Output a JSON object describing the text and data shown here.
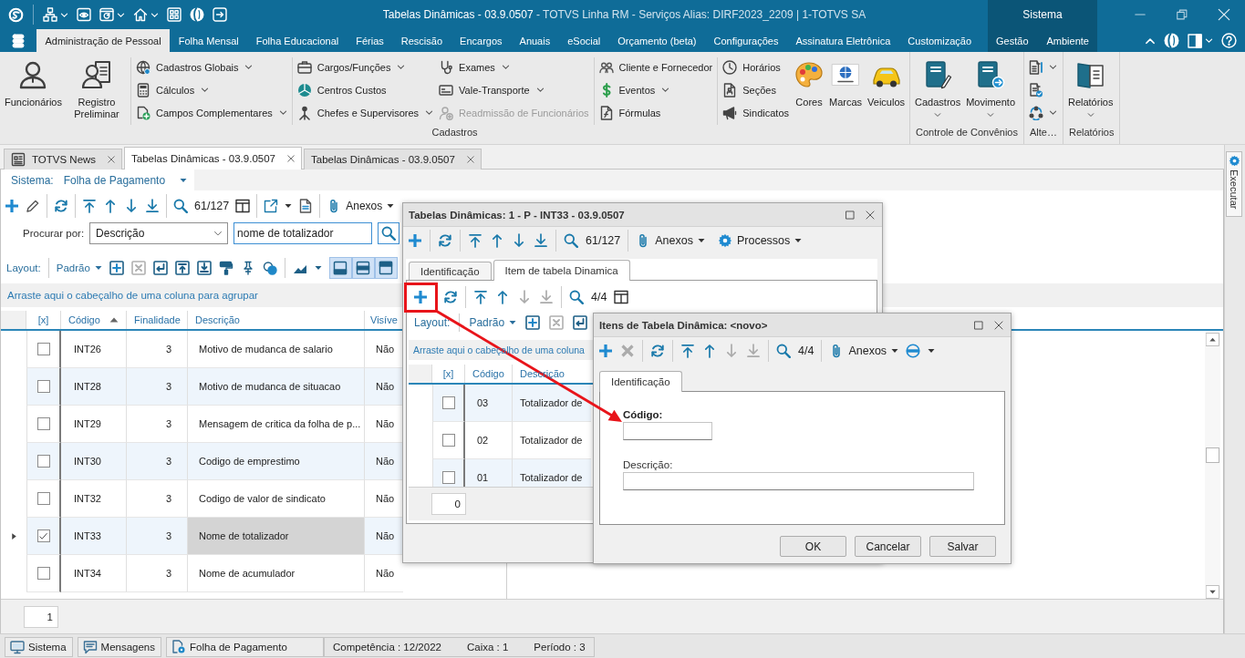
{
  "title_bar": {
    "title": "Tabelas Dinâmicas - 03.9.0507",
    "subtitle": "- TOTVS Linha RM - Serviços Alias: DIRF2023_2209 | 1-TOTVS SA",
    "context_label": "Sistema"
  },
  "ribbon": {
    "tabs": [
      {
        "label": "Administração de Pessoal",
        "selected": true
      },
      {
        "label": "Folha Mensal",
        "selected": false
      },
      {
        "label": "Folha Educacional",
        "selected": false
      },
      {
        "label": "Férias",
        "selected": false
      },
      {
        "label": "Rescisão",
        "selected": false
      },
      {
        "label": "Encargos",
        "selected": false
      },
      {
        "label": "Anuais",
        "selected": false
      },
      {
        "label": "eSocial",
        "selected": false
      },
      {
        "label": "Orçamento (beta)",
        "selected": false
      },
      {
        "label": "Configurações",
        "selected": false
      },
      {
        "label": "Assinatura Eletrônica",
        "selected": false
      },
      {
        "label": "Customização",
        "selected": false
      }
    ],
    "context_tabs": [
      {
        "label": "Gestão",
        "selected": false
      },
      {
        "label": "Ambiente",
        "selected": false
      }
    ],
    "groups": [
      {
        "label": "Cadastros",
        "clusters": [
          [
            {
              "kind": "large",
              "label": "Funcionários",
              "dropdown": false
            },
            {
              "kind": "large",
              "label": "Registro Preliminar",
              "dropdown": false
            }
          ],
          [
            {
              "kind": "stack",
              "items": [
                {
                  "label": "Cadastros Globais",
                  "dropdown": true,
                  "disabled": false
                },
                {
                  "label": "Cálculos",
                  "dropdown": true,
                  "disabled": false
                },
                {
                  "label": "Campos Complementares",
                  "dropdown": true,
                  "disabled": false
                }
              ]
            }
          ],
          [
            {
              "kind": "stack",
              "items": [
                {
                  "label": "Cargos/Funções",
                  "dropdown": true,
                  "disabled": false
                },
                {
                  "label": "Centros Custos",
                  "dropdown": false,
                  "disabled": false
                },
                {
                  "label": "Chefes e Supervisores",
                  "dropdown": true,
                  "disabled": false
                }
              ]
            },
            {
              "kind": "stack",
              "items": [
                {
                  "label": "Exames",
                  "dropdown": true,
                  "disabled": false
                },
                {
                  "label": "Vale-Transporte",
                  "dropdown": true,
                  "disabled": false
                },
                {
                  "label": "Readmissão de Funcionários",
                  "dropdown": false,
                  "disabled": true
                }
              ]
            }
          ],
          [
            {
              "kind": "stack",
              "items": [
                {
                  "label": "Cliente e Fornecedor",
                  "dropdown": false,
                  "disabled": false
                },
                {
                  "label": "Eventos",
                  "dropdown": true,
                  "disabled": false
                },
                {
                  "label": "Fórmulas",
                  "dropdown": false,
                  "disabled": false
                }
              ]
            }
          ],
          [
            {
              "kind": "stack",
              "items": [
                {
                  "label": "Horários",
                  "dropdown": false,
                  "disabled": false
                },
                {
                  "label": "Seções",
                  "dropdown": false,
                  "disabled": false
                },
                {
                  "label": "Sindicatos",
                  "dropdown": false,
                  "disabled": false
                }
              ]
            },
            {
              "kind": "large",
              "label": "Cores",
              "dropdown": false
            },
            {
              "kind": "large",
              "label": "Marcas",
              "dropdown": false
            },
            {
              "kind": "large",
              "label": "Veiculos",
              "dropdown": false
            }
          ]
        ]
      },
      {
        "label": "Controle de Convênios",
        "clusters": [
          [
            {
              "kind": "large",
              "label": "Cadastros",
              "dropdown": true
            },
            {
              "kind": "large",
              "label": "Movimento",
              "dropdown": true
            }
          ]
        ]
      },
      {
        "label": "Alte…",
        "clusters": [
          [
            {
              "kind": "icons",
              "items": [
                {
                  "dropdown": true
                },
                {
                  "dropdown": false
                },
                {
                  "dropdown": true
                }
              ]
            }
          ]
        ]
      },
      {
        "label": "Relatórios",
        "clusters": [
          [
            {
              "kind": "large",
              "label": "Relatórios",
              "dropdown": true
            }
          ]
        ]
      }
    ]
  },
  "document_tabs": [
    {
      "label": "TOTVS News",
      "selected": false
    },
    {
      "label": "Tabelas Dinâmicas - 03.9.0507",
      "selected": true
    },
    {
      "label": "Tabelas Dinâmicas - 03.9.0507",
      "selected": false
    }
  ],
  "side_panel": {
    "label": "Executar"
  },
  "main_view": {
    "system_selector": {
      "label": "Sistema:",
      "value": "Folha de Pagamento"
    },
    "toolbar": {
      "counter": "61/127",
      "attachments": "Anexos"
    },
    "search": {
      "label": "Procurar por:",
      "column": "Descrição",
      "value": "nome de totalizador"
    },
    "layout_bar": {
      "label": "Layout:",
      "preset": "Padrão",
      "delete_disabled": true,
      "view_toggles": [
        {
          "selected": true
        },
        {
          "selected": true
        },
        {
          "selected": true
        }
      ]
    },
    "group_hint": "Arraste aqui o cabeçalho de uma coluna para agrupar",
    "grid": {
      "check_column": "[x]",
      "columns": [
        {
          "label": "Código",
          "sorted": true
        },
        {
          "label": "Finalidade",
          "sorted": false
        },
        {
          "label": "Descrição",
          "sorted": false
        },
        {
          "label": "Visíve",
          "sorted": false
        }
      ],
      "rows": [
        {
          "checked": false,
          "selected": false,
          "cells": [
            "INT26",
            "3",
            "Motivo de mudanca de salario",
            "Não"
          ]
        },
        {
          "checked": false,
          "selected": false,
          "cells": [
            "INT28",
            "3",
            "Motivo de mudanca de situacao",
            "Não"
          ]
        },
        {
          "checked": false,
          "selected": false,
          "cells": [
            "INT29",
            "3",
            "Mensagem de critica da folha de p...",
            "Não"
          ]
        },
        {
          "checked": false,
          "selected": false,
          "cells": [
            "INT30",
            "3",
            "Codigo de emprestimo",
            "Não"
          ]
        },
        {
          "checked": false,
          "selected": false,
          "cells": [
            "INT32",
            "3",
            "Codigo de valor de sindicato",
            "Não"
          ]
        },
        {
          "checked": true,
          "selected": true,
          "cells": [
            "INT33",
            "3",
            "Nome de totalizador",
            "Não"
          ]
        },
        {
          "checked": false,
          "selected": false,
          "cells": [
            "INT34",
            "3",
            "Nome de acumulador",
            "Não"
          ]
        }
      ],
      "footer_count": "1"
    }
  },
  "record_dialog": {
    "title": "Tabelas Dinâmicas: 1 - P - INT33 - 03.9.0507",
    "toolbar": {
      "counter": "61/127",
      "attachments": "Anexos",
      "processes": "Processos"
    },
    "tabs": [
      {
        "label": "Identificação",
        "selected": false
      },
      {
        "label": "Item de tabela Dinamica",
        "selected": true
      }
    ],
    "items_toolbar": {
      "counter": "4/4",
      "next_disabled": true,
      "last_disabled": true
    },
    "layout_bar": {
      "label": "Layout:",
      "preset": "Padrão",
      "delete_disabled": true
    },
    "group_hint": "Arraste aqui o cabeçalho de uma coluna",
    "grid": {
      "check_column": "[x]",
      "columns": [
        "Código",
        "Descrição"
      ],
      "rows": [
        {
          "checked": false,
          "cells": [
            "03",
            "Totalizador de"
          ]
        },
        {
          "checked": false,
          "cells": [
            "02",
            "Totalizador de"
          ]
        },
        {
          "checked": false,
          "cells": [
            "01",
            "Totalizador de"
          ]
        }
      ],
      "footer_count": "0"
    }
  },
  "item_dialog": {
    "title": "Itens de Tabela Dinâmica: <novo>",
    "toolbar": {
      "counter": "4/4",
      "attachments": "Anexos",
      "delete_disabled": true,
      "next_disabled": true,
      "last_disabled": true
    },
    "tabs": [
      {
        "label": "Identificação",
        "selected": true
      }
    ],
    "fields": [
      {
        "label": "Código:",
        "required": true,
        "kind": "short"
      },
      {
        "label": "Descrição:",
        "required": false,
        "kind": "long"
      }
    ],
    "buttons": [
      "OK",
      "Cancelar",
      "Salvar"
    ]
  },
  "status_bar": {
    "buttons": [
      "Sistema",
      "Mensagens",
      "Folha de Pagamento"
    ],
    "fields": [
      "Competência : 12/2022",
      "Caixa : 1",
      "Período : 3"
    ]
  }
}
